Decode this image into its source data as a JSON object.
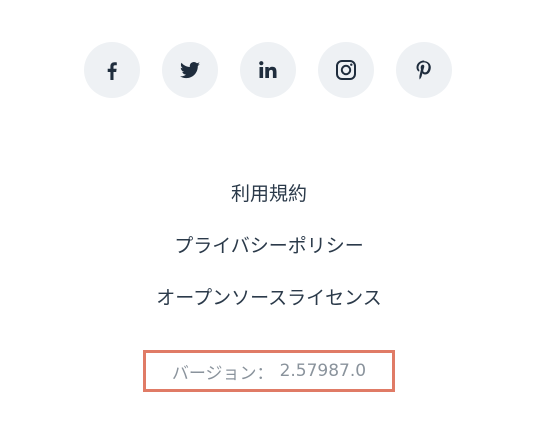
{
  "social": [
    {
      "icon": "facebook-icon"
    },
    {
      "icon": "twitter-icon"
    },
    {
      "icon": "linkedin-icon"
    },
    {
      "icon": "instagram-icon"
    },
    {
      "icon": "pinterest-icon"
    }
  ],
  "links": {
    "terms": "利用規約",
    "privacy": "プライバシーポリシー",
    "oss": "オープンソースライセンス"
  },
  "version": {
    "label": "バージョン：",
    "value": "2.57987.0"
  },
  "colors": {
    "icon_bg": "#eef1f4",
    "icon_fg": "#1f2d3d",
    "text": "#2b3a4a",
    "muted": "#8a939c",
    "highlight": "#e07b66"
  }
}
